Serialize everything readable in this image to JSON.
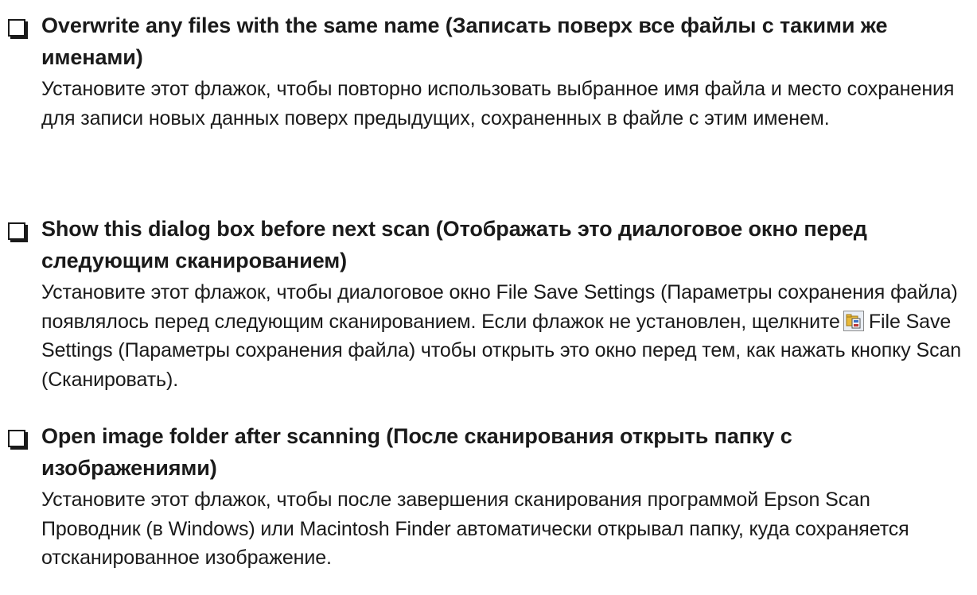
{
  "options": [
    {
      "title": "Overwrite any files with the same name (Записать поверх все файлы с такими же именами)",
      "description": "Установите этот флажок, чтобы повторно использовать выбранное имя файла и место сохранения для записи новых данных поверх предыдущих, сохраненных в файле с этим именем."
    },
    {
      "title": "Show this dialog box before next scan (Отображать это диалоговое окно перед следующим сканированием)",
      "description_before_icon": "Установите этот флажок, чтобы диалоговое окно File Save Settings (Параметры сохранения файла) появлялось перед следующим сканированием. Если флажок не установлен, щелкните",
      "description_after_icon": "File Save Settings (Параметры сохранения файла) чтобы открыть это окно перед тем, как нажать кнопку Scan (Сканировать).",
      "inline_icon": "file-save-settings-icon"
    },
    {
      "title": "Open image folder after scanning (После сканирования открыть папку с изображениями)",
      "description": "Установите этот флажок, чтобы после завершения сканирования программой Epson Scan Проводник (в Windows) или Macintosh Finder автоматически открывал папку, куда сохраняется отсканированное изображение."
    }
  ],
  "colors": {
    "text": "#1a1a1a",
    "background": "#ffffff",
    "icon_folder": "#e8b93a",
    "icon_frame": "#8a8a8a"
  }
}
